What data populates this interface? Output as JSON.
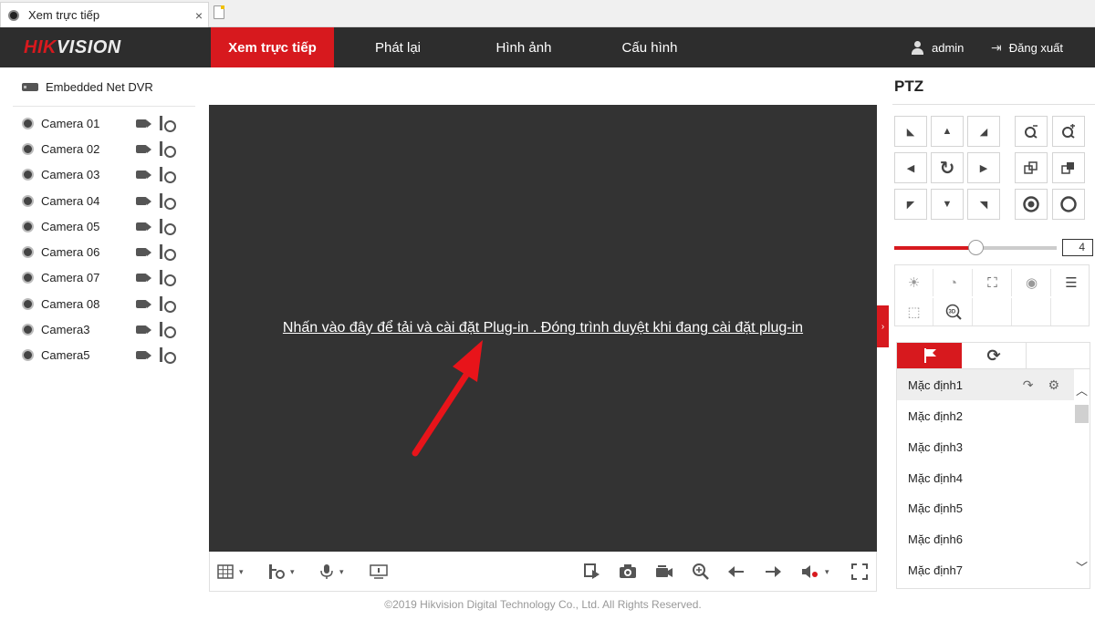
{
  "browser": {
    "tab_title": "Xem trực tiếp",
    "close_glyph": "×"
  },
  "header": {
    "logo_red": "HIK",
    "logo_white": "VISION",
    "nav": [
      "Xem trực tiếp",
      "Phát lại",
      "Hình ảnh",
      "Cấu hình"
    ],
    "active_nav": "Xem trực tiếp",
    "user": "admin",
    "logout": "Đăng xuất"
  },
  "device_tree": {
    "root": "Embedded Net DVR",
    "cameras": [
      "Camera 01",
      "Camera 02",
      "Camera 03",
      "Camera 04",
      "Camera 05",
      "Camera 06",
      "Camera 07",
      "Camera 08",
      "Camera3",
      "Camera5"
    ]
  },
  "video": {
    "plugin_message": "Nhấn vào đây để tải và cài đặt Plug-in . Đóng trình duyệt khi đang cài đặt plug-in",
    "annotation_arrow_color": "#e8141a",
    "collapse_glyph": "›"
  },
  "toolbar": {
    "layout_icon": "grid-layout-icon",
    "stream_icon": "stream-icon",
    "mic_icon": "microphone-icon",
    "caret": "▾"
  },
  "footer": "©2019 Hikvision Digital Technology Co., Ltd. All Rights Reserved.",
  "ptz": {
    "title": "PTZ",
    "speed_value": "4",
    "speed_fraction": 0.5,
    "presets": [
      "Mặc định1",
      "Mặc định2",
      "Mặc định3",
      "Mặc định4",
      "Mặc định5",
      "Mặc định6",
      "Mặc định7"
    ],
    "selected_preset": "Mặc định1"
  },
  "colors": {
    "brand_red": "#d7191e",
    "header_bg": "#2d2d2d",
    "video_bg": "#333333"
  }
}
